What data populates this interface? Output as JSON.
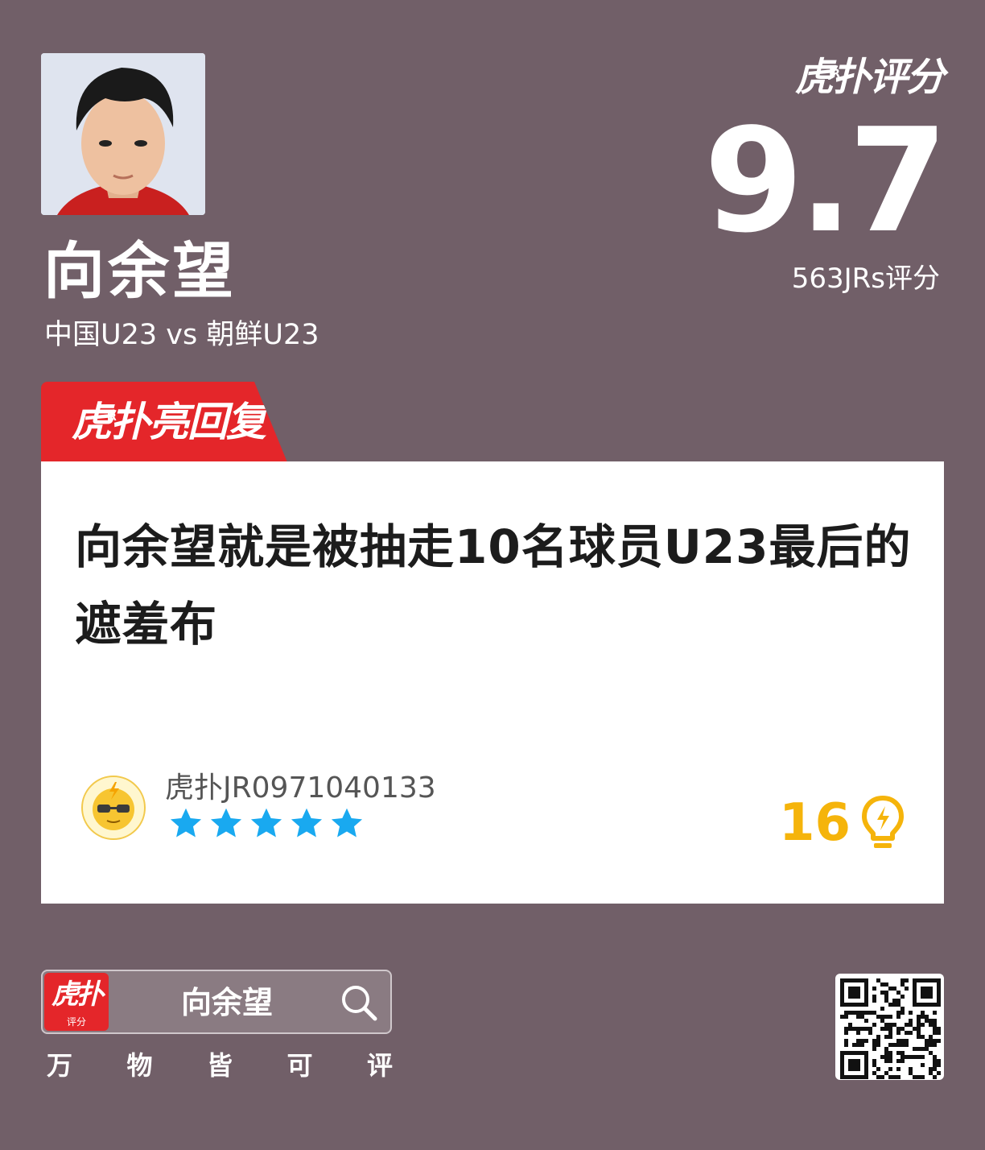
{
  "player": {
    "name": "向余望",
    "match": "中国U23 vs 朝鲜U23",
    "photo_icon": "player-portrait"
  },
  "rating": {
    "brand": "虎扑评分",
    "brand_mark": "JR",
    "score": "9.7",
    "count": "563JRs评分"
  },
  "hot_reply": {
    "tag": "虎扑亮回复",
    "tag_mark": "JR",
    "comment": "向余望就是被抽走10名球员U23最后的遮羞布",
    "user": "虎扑JR0971040133",
    "stars": 5,
    "likes": "16",
    "like_icon": "lightbulb-icon"
  },
  "footer": {
    "app_name": "虎扑",
    "app_mark": "JR",
    "app_sub": "评分",
    "search_query": "向余望",
    "slogan": [
      "万",
      "物",
      "皆",
      "可",
      "评"
    ]
  },
  "colors": {
    "background": "#715f68",
    "accent_red": "#e4262a",
    "star_blue": "#19a9f0",
    "like_gold": "#f5b40b"
  }
}
